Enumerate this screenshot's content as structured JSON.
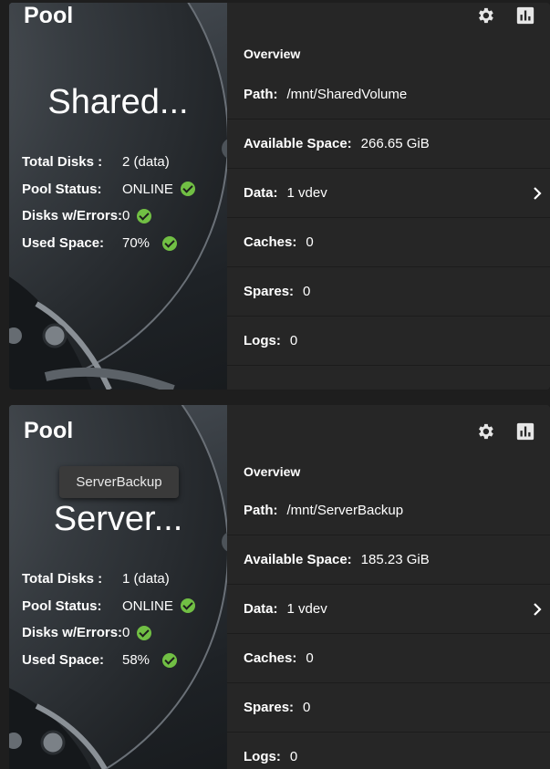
{
  "pools": [
    {
      "section_title": "Pool",
      "name_display": "Shared...",
      "tooltip": "",
      "stats": [
        {
          "label": "Total Disks :",
          "value": "2 (data)",
          "check": false
        },
        {
          "label": "Pool Status:",
          "value": "ONLINE",
          "check": true
        },
        {
          "label": "Disks w/Errors:",
          "value": "0",
          "check": true
        },
        {
          "label": "Used Space:",
          "value": "70%",
          "check": true
        }
      ],
      "icons": [
        "gear-icon",
        "bar-chart-icon"
      ],
      "overview_title": "Overview",
      "details": [
        {
          "label": "Path:",
          "value": "/mnt/SharedVolume",
          "chevron": false
        },
        {
          "label": "Available Space:",
          "value": "266.65 GiB",
          "chevron": false
        },
        {
          "label": "Data:",
          "value": "1 vdev",
          "chevron": true
        },
        {
          "label": "Caches:",
          "value": "0",
          "chevron": false
        },
        {
          "label": "Spares:",
          "value": "0",
          "chevron": false
        },
        {
          "label": "Logs:",
          "value": "0",
          "chevron": false
        }
      ]
    },
    {
      "section_title": "Pool",
      "name_display": "Server...",
      "tooltip": "ServerBackup",
      "stats": [
        {
          "label": "Total Disks :",
          "value": "1 (data)",
          "check": false
        },
        {
          "label": "Pool Status:",
          "value": "ONLINE",
          "check": true
        },
        {
          "label": "Disks w/Errors:",
          "value": "0",
          "check": true
        },
        {
          "label": "Used Space:",
          "value": "58%",
          "check": true
        }
      ],
      "icons": [
        "gear-icon",
        "bar-chart-icon"
      ],
      "overview_title": "Overview",
      "details": [
        {
          "label": "Path:",
          "value": "/mnt/ServerBackup",
          "chevron": false
        },
        {
          "label": "Available Space:",
          "value": "185.23 GiB",
          "chevron": false
        },
        {
          "label": "Data:",
          "value": "1 vdev",
          "chevron": true
        },
        {
          "label": "Caches:",
          "value": "0",
          "chevron": false
        },
        {
          "label": "Spares:",
          "value": "0",
          "chevron": false
        },
        {
          "label": "Logs:",
          "value": "0",
          "chevron": false
        }
      ]
    }
  ],
  "colors": {
    "background": "#1e1e1e",
    "card": "#282828",
    "check_green": "#71bf44",
    "text": "#ffffff"
  }
}
